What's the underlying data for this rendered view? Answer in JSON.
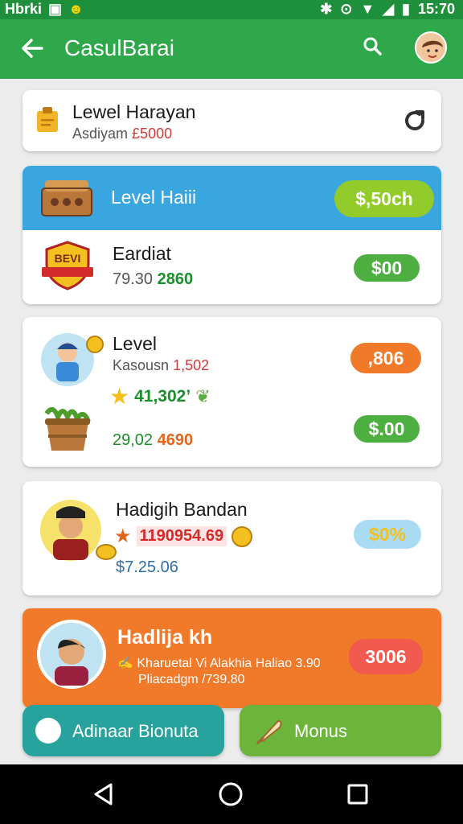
{
  "status": {
    "carrier": "Hbrki",
    "time": "15:70"
  },
  "appbar": {
    "title": "CasulBarai"
  },
  "card1": {
    "title": "Lewel Harayan",
    "sub_label": "Asdiyam",
    "sub_value": "£5000"
  },
  "card2": {
    "header_title": "Level Haiii",
    "header_price": "$,50ch",
    "badge_text": "BEVI",
    "title": "Eardiat",
    "num1": "79.30",
    "num2": "2860",
    "price": "$00"
  },
  "card3": {
    "title": "Level",
    "sub_label": "Kasousn",
    "sub_value": "1,502",
    "star_value": "41,302’",
    "pill1": ",806",
    "bottom_num1": "29,02",
    "bottom_num2": "4690",
    "pill2": "$.00"
  },
  "card4": {
    "title": "Hadigih Bandan",
    "star_value": "1190954.69",
    "bottom_value": "$7.25.06",
    "pill": "$0%"
  },
  "card5": {
    "title": "Hadlija kh",
    "line1": "Kharuetal Vi Alakhia Haliao 3.90",
    "line2": "Pliacadgm /739.80",
    "pill": "3006"
  },
  "buttons": {
    "left": "Adinaar Bionuta",
    "right": "Monus"
  },
  "colors": {
    "appbar": "#2ea84a",
    "blue_header": "#3aa6e0",
    "orange_card": "#f07a2a",
    "teal_button": "#27a29c",
    "green_button": "#6cb43c"
  }
}
